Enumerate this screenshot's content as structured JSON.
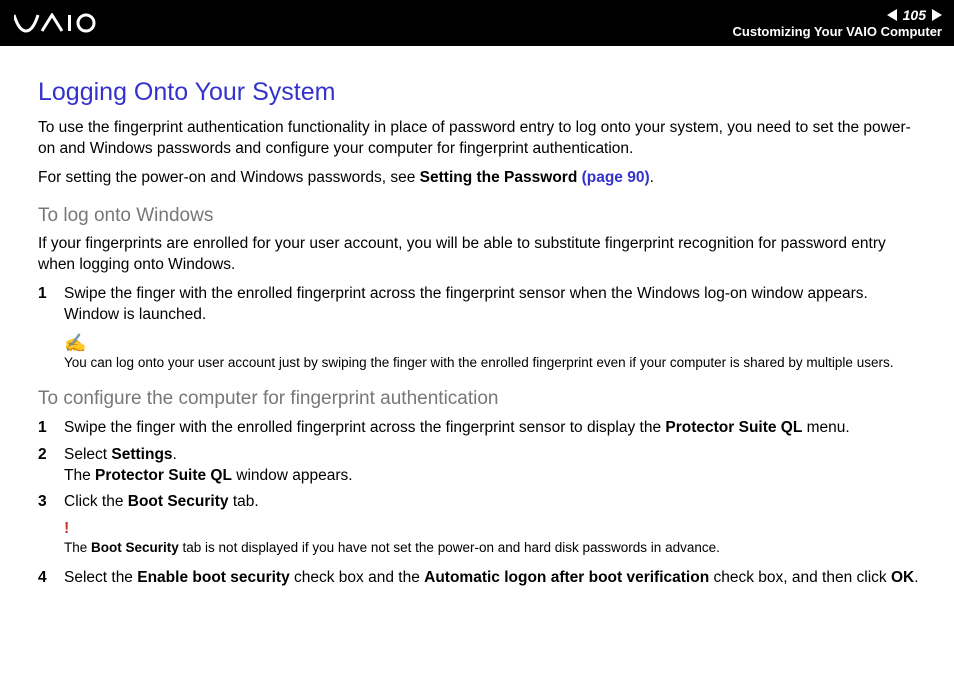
{
  "header": {
    "page_number": "105",
    "section": "Customizing Your VAIO Computer"
  },
  "title": "Logging Onto Your System",
  "intro1": "To use the fingerprint authentication functionality in place of password entry to log onto your system, you need to set the power-on and Windows passwords and configure your computer for fingerprint authentication.",
  "intro2_a": "For setting the power-on and Windows passwords, see ",
  "intro2_b": "Setting the Password ",
  "intro2_c": "(page 90)",
  "intro2_d": ".",
  "h2_1": "To log onto Windows",
  "p_win": "If your fingerprints are enrolled for your user account, you will be able to substitute fingerprint recognition for password entry when logging onto Windows.",
  "win_step1_num": "1",
  "win_step1": "Swipe the finger with the enrolled fingerprint across the fingerprint sensor when the Windows log-on window appears. Window is launched.",
  "note1": "You can log onto your user account just by swiping the finger with the enrolled fingerprint even if your computer is shared by multiple users.",
  "h2_2": "To configure the computer for fingerprint authentication",
  "cfg_step1_num": "1",
  "cfg_step1_a": "Swipe the finger with the enrolled fingerprint across the fingerprint sensor to display the ",
  "cfg_step1_b": "Protector Suite QL",
  "cfg_step1_c": " menu.",
  "cfg_step2_num": "2",
  "cfg_step2_a": "Select ",
  "cfg_step2_b": "Settings",
  "cfg_step2_c": ".",
  "cfg_step2_d": "The ",
  "cfg_step2_e": "Protector Suite QL",
  "cfg_step2_f": " window appears.",
  "cfg_step3_num": "3",
  "cfg_step3_a": " Click the ",
  "cfg_step3_b": "Boot Security",
  "cfg_step3_c": " tab.",
  "warn_a": "The ",
  "warn_b": "Boot Security",
  "warn_c": " tab is not displayed if you have not set the power-on and hard disk passwords in advance.",
  "cfg_step4_num": "4",
  "cfg_step4_a": "Select the ",
  "cfg_step4_b": "Enable boot security",
  "cfg_step4_c": " check box and the ",
  "cfg_step4_d": "Automatic logon after boot verification",
  "cfg_step4_e": " check box, and then click ",
  "cfg_step4_f": "OK",
  "cfg_step4_g": "."
}
